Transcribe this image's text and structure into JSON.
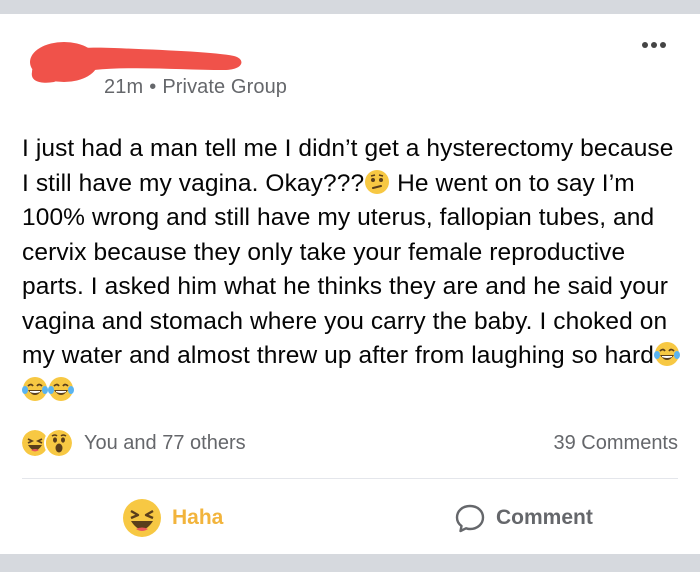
{
  "post": {
    "meta_time": "21m",
    "meta_separator": "•",
    "meta_audience": "Private Group",
    "text_1": "I just had a man tell me I didn’t get a hysterectomy because I still have my vagina. Okay???",
    "text_2": " He went on to say I’m 100% wrong and still have my uterus, fallopian tubes, and cervix because they only take your female reproductive parts. I asked him what he thinks they are and he said your vagina and stomach where you carry the baby. I choked on my water and almost threw up after from laughing so hard",
    "inline_emojis": [
      "thinking-face-icon",
      "tears-of-joy-icon",
      "tears-of-joy-icon",
      "tears-of-joy-icon"
    ]
  },
  "stats": {
    "reaction_icons": [
      "haha-reaction-icon",
      "wow-reaction-icon"
    ],
    "reactions_text": "You and 77 others",
    "comments_text": "39 Comments"
  },
  "actions": {
    "haha_label": "Haha",
    "comment_label": "Comment"
  },
  "colors": {
    "redaction": "#f0524a",
    "haha_yellow": "#f7c843",
    "haha_text": "#f2b43c",
    "secondary_text": "#65676b"
  }
}
